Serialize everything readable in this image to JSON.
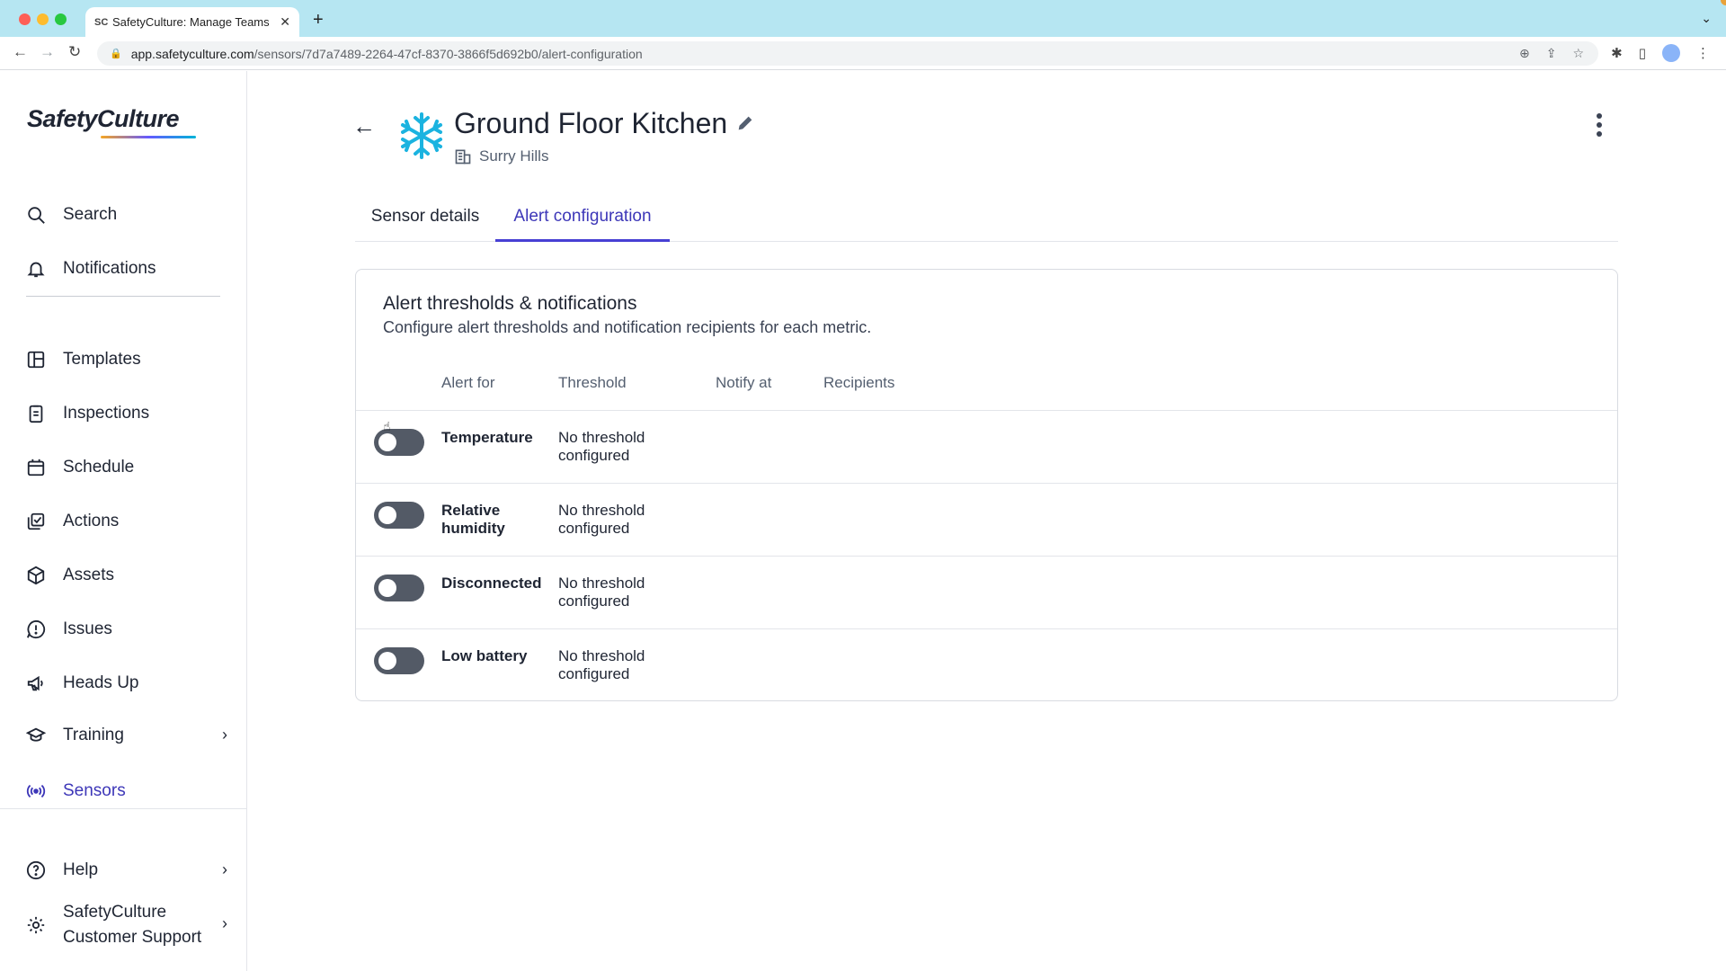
{
  "browser": {
    "tab_favicon": "SC",
    "tab_title": "SafetyCulture: Manage Teams",
    "url_domain": "app.safetyculture.com",
    "url_path": "/sensors/7d7a7489-2264-47cf-8370-3866f5d692b0/alert-configuration"
  },
  "sidebar": {
    "logo": "SafetyCulture",
    "items": [
      {
        "label": "Search",
        "icon": "search-icon"
      },
      {
        "label": "Notifications",
        "icon": "bell-icon"
      },
      {
        "label": "Templates",
        "icon": "templates-icon"
      },
      {
        "label": "Inspections",
        "icon": "clipboard-icon"
      },
      {
        "label": "Schedule",
        "icon": "calendar-icon"
      },
      {
        "label": "Actions",
        "icon": "actions-icon"
      },
      {
        "label": "Assets",
        "icon": "cube-icon"
      },
      {
        "label": "Issues",
        "icon": "alert-icon"
      },
      {
        "label": "Heads Up",
        "icon": "megaphone-icon"
      },
      {
        "label": "Training",
        "icon": "graduation-cap-icon"
      },
      {
        "label": "Sensors",
        "icon": "sensor-icon"
      },
      {
        "label": "Help",
        "icon": "help-icon"
      }
    ],
    "org_line1": "SafetyCulture",
    "org_line2": "Customer Support"
  },
  "header": {
    "title": "Ground Floor Kitchen",
    "site": "Surry Hills"
  },
  "tabs": [
    {
      "label": "Sensor details"
    },
    {
      "label": "Alert configuration"
    }
  ],
  "card": {
    "title": "Alert thresholds & notifications",
    "description": "Configure alert thresholds and notification recipients for each metric.",
    "columns": [
      "Alert for",
      "Threshold",
      "Notify at",
      "Recipients"
    ],
    "rows": [
      {
        "metric_l1": "Temperature",
        "metric_l2": "",
        "threshold_l1": "No threshold",
        "threshold_l2": "configured"
      },
      {
        "metric_l1": "Relative",
        "metric_l2": "humidity",
        "threshold_l1": "No threshold",
        "threshold_l2": "configured"
      },
      {
        "metric_l1": "Disconnected",
        "metric_l2": "",
        "threshold_l1": "No threshold",
        "threshold_l2": "configured"
      },
      {
        "metric_l1": "Low battery",
        "metric_l2": "",
        "threshold_l1": "No threshold",
        "threshold_l2": "configured"
      }
    ]
  },
  "colors": {
    "accent": "#4740d4",
    "toggle_off": "#535a66",
    "sensor_icon": "#1bb3e0"
  }
}
